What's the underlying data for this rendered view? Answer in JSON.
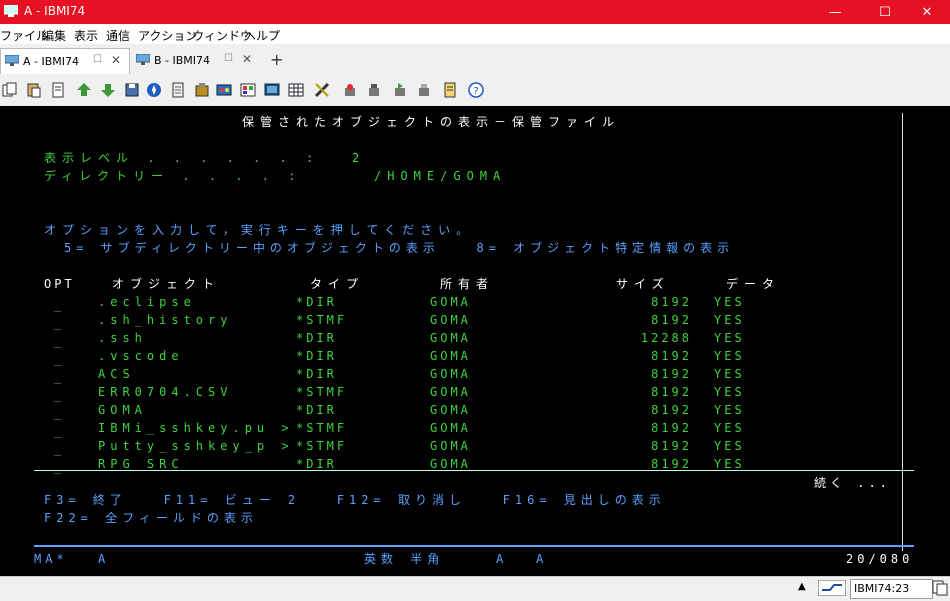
{
  "window": {
    "title": "A - IBMI74",
    "minimize": "—",
    "maximize": "☐",
    "close": "✕",
    "accent": "#e81123"
  },
  "menu": [
    "ファイル",
    "編集",
    "表示",
    "通信",
    "アクション",
    "ウィンドウ",
    "ヘルプ"
  ],
  "tabs": [
    {
      "label": "A - IBMI74",
      "active": true
    },
    {
      "label": "B - IBMI74",
      "active": false
    }
  ],
  "toolbar_icons": [
    "copy-icon",
    "paste-icon",
    "print-screen-icon",
    "upload-icon",
    "download-icon",
    "save-icon",
    "compass-icon",
    "notes-icon",
    "macro-icon",
    "keyboard-map-icon",
    "color-icon",
    "display-icon",
    "grid-icon",
    "ruler-icon",
    "record-icon",
    "stop-icon",
    "play-icon",
    "clipboard-icon",
    "list-icon",
    "help-icon"
  ],
  "screen": {
    "title": "保管されたオブジェクトの表示－保管ファイル",
    "level_label": "表示レベル . . . . . . :",
    "level_value": "2",
    "dir_label": "ディレクトリー . . . . :",
    "dir_value": "/HOME/GOMA",
    "instruction": "オプションを入力して，実行キーを押してください。",
    "options_line": "5= サブディレクトリー中のオブジェクトの表示   8= オブジェクト特定情報の表示",
    "headers": {
      "opt": "OPT",
      "object": "オブジェクト",
      "type": "タイプ",
      "owner": "所有者",
      "size": "サイズ",
      "data": "データ"
    },
    "rows": [
      {
        "opt": "_",
        "object": ".eclipse",
        "type": "*DIR",
        "owner": "GOMA",
        "size": "8192",
        "data": "YES"
      },
      {
        "opt": "_",
        "object": ".sh_history",
        "type": "*STMF",
        "owner": "GOMA",
        "size": "8192",
        "data": "YES"
      },
      {
        "opt": "_",
        "object": ".ssh",
        "type": "*DIR",
        "owner": "GOMA",
        "size": "12288",
        "data": "YES"
      },
      {
        "opt": "_",
        "object": ".vscode",
        "type": "*DIR",
        "owner": "GOMA",
        "size": "8192",
        "data": "YES"
      },
      {
        "opt": "_",
        "object": "ACS",
        "type": "*DIR",
        "owner": "GOMA",
        "size": "8192",
        "data": "YES"
      },
      {
        "opt": "_",
        "object": "ERR0704.CSV",
        "type": "*STMF",
        "owner": "GOMA",
        "size": "8192",
        "data": "YES"
      },
      {
        "opt": "_",
        "object": "GOMA",
        "type": "*DIR",
        "owner": "GOMA",
        "size": "8192",
        "data": "YES"
      },
      {
        "opt": "_",
        "object": "IBMi_sshkey.pu >",
        "type": "*STMF",
        "owner": "GOMA",
        "size": "8192",
        "data": "YES"
      },
      {
        "opt": "_",
        "object": "Putty_sshkey_p >",
        "type": "*STMF",
        "owner": "GOMA",
        "size": "8192",
        "data": "YES"
      },
      {
        "opt": "_",
        "object": "RPG_SRC",
        "type": "*DIR",
        "owner": "GOMA",
        "size": "8192",
        "data": "YES"
      }
    ],
    "more": "続く ...",
    "fkeys1": "F3= 終了   F11= ビュー 2   F12= 取り消し   F16= 見出しの表示",
    "fkeys2": "F22= 全フィールドの表示"
  },
  "oia": {
    "left": "MA*",
    "session": "A",
    "input_mode": "英数 半角",
    "mode2": "A",
    "mode3": "A",
    "position": "20/080"
  },
  "statusbar": {
    "host": "IBMI74:23"
  }
}
